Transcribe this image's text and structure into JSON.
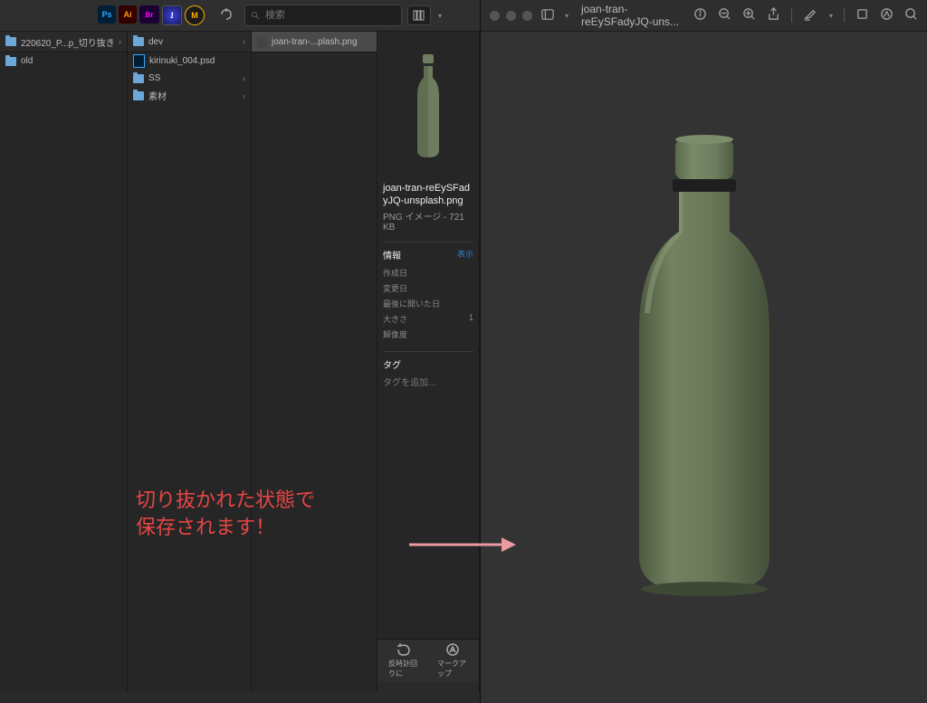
{
  "toolbar": {
    "apps": [
      "Ps",
      "Ai",
      "Br",
      "1",
      "M"
    ],
    "search_placeholder": "検索",
    "search_icon": "search"
  },
  "columns": {
    "col1": {
      "header": "220620_P...p_切り抜き",
      "items": [
        {
          "name": "old",
          "type": "folder"
        }
      ]
    },
    "col2": {
      "header": "dev",
      "items": [
        {
          "name": "kirinuki_004.psd",
          "type": "psd"
        },
        {
          "name": "SS",
          "type": "folder"
        },
        {
          "name": "素材",
          "type": "folder"
        }
      ]
    },
    "col3": {
      "header": "joan-tran-...plash.png",
      "type": "png"
    }
  },
  "detail": {
    "filename": "joan-tran-reEySFadyJQ-unsplash.png",
    "filetype": "PNG イメージ - 721 KB",
    "info_label": "情報",
    "show_label": "表示",
    "rows": {
      "created": "作成日",
      "modified": "変更日",
      "lastopen": "最後に開いた日",
      "size": "大きさ",
      "sizeval": "1",
      "res": "解像度"
    },
    "tags_label": "タグ",
    "tags_add": "タグを追加..."
  },
  "bottombar": {
    "rotate": "反時計回りに",
    "markup": "マークアップ"
  },
  "annotation": {
    "line1": "切り抜かれた状態で",
    "line2": "保存されます！"
  },
  "preview": {
    "title": "joan-tran-reEySFadyJQ-uns..."
  }
}
